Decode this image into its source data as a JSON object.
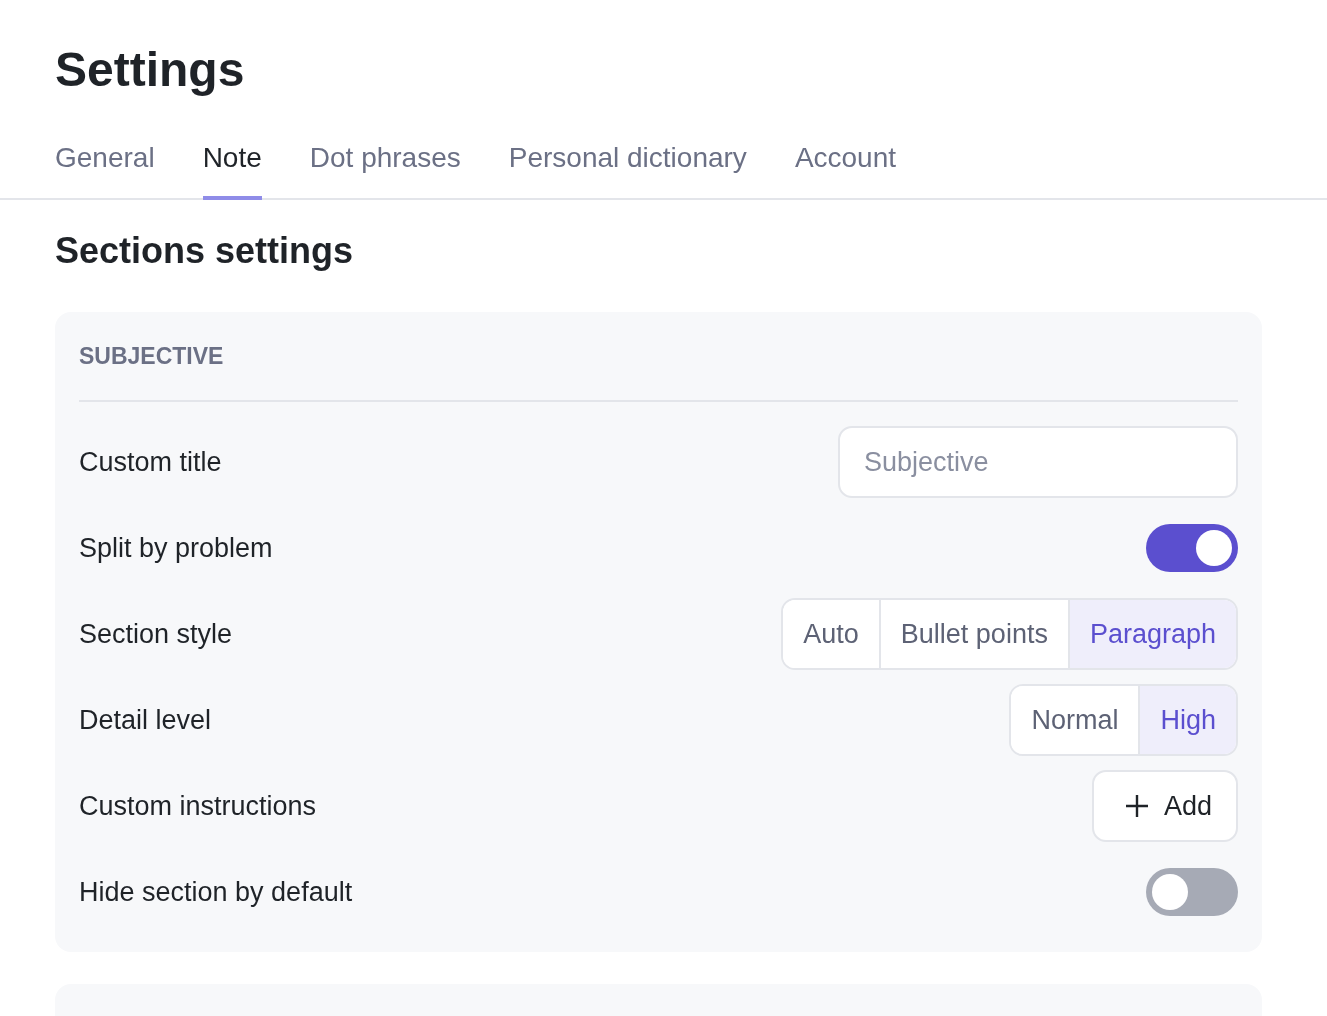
{
  "title": "Settings",
  "tabs": [
    {
      "label": "General",
      "selected": false
    },
    {
      "label": "Note",
      "selected": true
    },
    {
      "label": "Dot phrases",
      "selected": false
    },
    {
      "label": "Personal dictionary",
      "selected": false
    },
    {
      "label": "Account",
      "selected": false
    }
  ],
  "heading": "Sections settings",
  "sections": [
    {
      "title": "SUBJECTIVE",
      "rows": [
        {
          "kind": "input",
          "label": "Custom title",
          "placeholder": "Subjective"
        },
        {
          "kind": "toggle",
          "label": "Split by problem",
          "on": true
        },
        {
          "kind": "segmented",
          "label": "Section style",
          "options": [
            {
              "label": "Auto",
              "selected": false
            },
            {
              "label": "Bullet points",
              "selected": false
            },
            {
              "label": "Paragraph",
              "selected": true
            }
          ]
        },
        {
          "kind": "segmented",
          "label": "Detail level",
          "options": [
            {
              "label": "Normal",
              "selected": false
            },
            {
              "label": "High",
              "selected": true
            }
          ]
        },
        {
          "kind": "button",
          "label": "Custom instructions",
          "button": "Add"
        },
        {
          "kind": "toggle",
          "label": "Hide section by default",
          "on": false
        }
      ]
    }
  ]
}
